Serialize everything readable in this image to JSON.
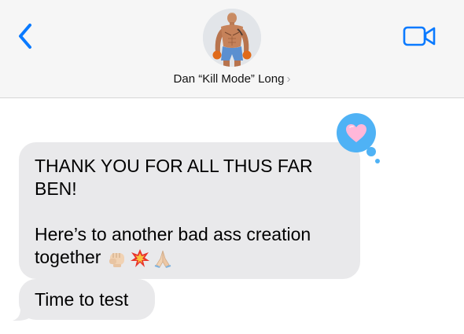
{
  "header": {
    "contact_name": "Dan “Kill Mode” Long",
    "chevron": "›",
    "back_icon": "chevron-left-icon",
    "video_icon": "video-camera-icon",
    "accent_color": "#0a7aff"
  },
  "messages": [
    {
      "sender": "incoming",
      "lines": [
        "THANK YOU FOR ALL THUS FAR",
        "BEN!",
        "",
        "Here’s to another bad ass creation",
        "together"
      ],
      "emojis": [
        "oncoming-fist-emoji",
        "collision-emoji",
        "folded-hands-emoji"
      ],
      "tapback": "heart"
    },
    {
      "sender": "incoming",
      "lines": [
        "Time to test"
      ]
    }
  ],
  "colors": {
    "incoming_bubble": "#e9e9eb",
    "header_bg": "#f6f6f6",
    "tapback_bubble": "#4fb2f5",
    "heart": "#ffb7d9"
  }
}
